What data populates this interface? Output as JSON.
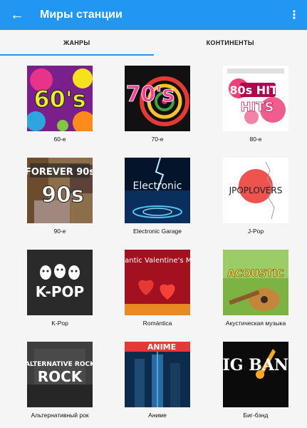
{
  "appbar": {
    "title": "Миры станции",
    "back_icon": "arrow-left-icon",
    "menu_icon": "more-vert-icon"
  },
  "tabs": [
    {
      "label": "ЖАНРЫ",
      "active": true
    },
    {
      "label": "КОНТИНЕНТЫ",
      "active": false
    }
  ],
  "genres": [
    {
      "label": "60-е",
      "cover_text": "60's"
    },
    {
      "label": "70-е",
      "cover_text": "70's"
    },
    {
      "label": "80-е",
      "cover_text": "80s HITS"
    },
    {
      "label": "90-е",
      "cover_text": "FOREVER 90s"
    },
    {
      "label": "Electronic Garage",
      "cover_text": "Electronic"
    },
    {
      "label": "J-Pop",
      "cover_text": "JPOPLOVERS"
    },
    {
      "label": "K-Pop",
      "cover_text": "K-POP"
    },
    {
      "label": "Romántica",
      "cover_text": "Romantic Valentine's Music"
    },
    {
      "label": "Акустическая музыка",
      "cover_text": "ACOUSTIC"
    },
    {
      "label": "Альтернативный рок",
      "cover_text": "ALTERNATIVE ROCK"
    },
    {
      "label": "Аниме",
      "cover_text": "ANIME"
    },
    {
      "label": "Биг-бэнд",
      "cover_text": "BIG BAND"
    }
  ],
  "colors": {
    "primary": "#2196f3",
    "background": "#f5f5f5"
  }
}
